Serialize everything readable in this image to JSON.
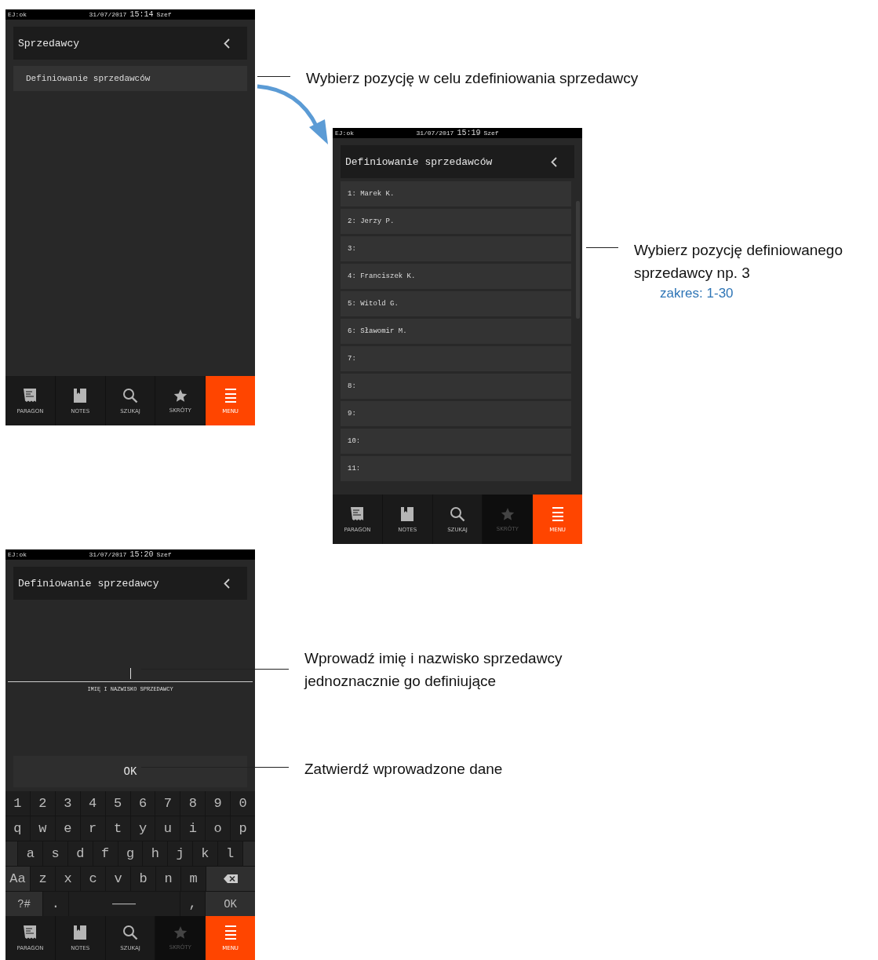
{
  "screens": [
    {
      "kind": "menu",
      "status": {
        "left": "EJ:ok",
        "date": "31/07/2017",
        "time": "15:14",
        "user": "Szef"
      },
      "title": "Sprzedawcy",
      "items": [
        {
          "label": "Definiowanie sprzedawców"
        }
      ],
      "nav": [
        {
          "label": "PARAGON",
          "selected": false,
          "disabled": false
        },
        {
          "label": "NOTES",
          "selected": false,
          "disabled": false
        },
        {
          "label": "SZUKAJ",
          "selected": false,
          "disabled": false
        },
        {
          "label": "SKRÓTY",
          "selected": false,
          "disabled": false
        },
        {
          "label": "MENU",
          "selected": true,
          "disabled": false
        }
      ]
    },
    {
      "kind": "list",
      "status": {
        "left": "EJ:ok",
        "date": "31/07/2017",
        "time": "15:19",
        "user": "Szef"
      },
      "title": "Definiowanie sprzedawców",
      "items": [
        {
          "label": "1: Marek K."
        },
        {
          "label": "2: Jerzy P."
        },
        {
          "label": "3:"
        },
        {
          "label": "4: Franciszek K."
        },
        {
          "label": "5: Witold G."
        },
        {
          "label": "6: Sławomir M."
        },
        {
          "label": "7:"
        },
        {
          "label": "8:"
        },
        {
          "label": "9:"
        },
        {
          "label": "10:"
        },
        {
          "label": "11:"
        }
      ],
      "nav": [
        {
          "label": "PARAGON",
          "selected": false,
          "disabled": false
        },
        {
          "label": "NOTES",
          "selected": false,
          "disabled": false
        },
        {
          "label": "SZUKAJ",
          "selected": false,
          "disabled": false
        },
        {
          "label": "SKRÓTY",
          "selected": false,
          "disabled": true
        },
        {
          "label": "MENU",
          "selected": true,
          "disabled": false
        }
      ]
    },
    {
      "kind": "form",
      "status": {
        "left": "EJ:ok",
        "date": "31/07/2017",
        "time": "15:20",
        "user": "Szef"
      },
      "title": "Definiowanie sprzedawcy",
      "input": {
        "label": "IMIĘ I NAZWISKO SPRZEDAWCY"
      },
      "ok_button": "OK",
      "keyboard": [
        {
          "keys": [
            {
              "kind": "char",
              "label": "1"
            },
            {
              "kind": "char",
              "label": "2"
            },
            {
              "kind": "char",
              "label": "3"
            },
            {
              "kind": "char",
              "label": "4"
            },
            {
              "kind": "char",
              "label": "5"
            },
            {
              "kind": "char",
              "label": "6"
            },
            {
              "kind": "char",
              "label": "7"
            },
            {
              "kind": "char",
              "label": "8"
            },
            {
              "kind": "char",
              "label": "9"
            },
            {
              "kind": "char",
              "label": "0"
            }
          ]
        },
        {
          "keys": [
            {
              "kind": "char",
              "label": "q"
            },
            {
              "kind": "char",
              "label": "w"
            },
            {
              "kind": "char",
              "label": "e"
            },
            {
              "kind": "char",
              "label": "r"
            },
            {
              "kind": "char",
              "label": "t"
            },
            {
              "kind": "char",
              "label": "y"
            },
            {
              "kind": "char",
              "label": "u"
            },
            {
              "kind": "char",
              "label": "i"
            },
            {
              "kind": "char",
              "label": "o"
            },
            {
              "kind": "char",
              "label": "p"
            }
          ]
        },
        {
          "keys": [
            {
              "kind": "spacer"
            },
            {
              "kind": "char",
              "label": "a"
            },
            {
              "kind": "char",
              "label": "s"
            },
            {
              "kind": "char",
              "label": "d"
            },
            {
              "kind": "char",
              "label": "f"
            },
            {
              "kind": "char",
              "label": "g"
            },
            {
              "kind": "char",
              "label": "h"
            },
            {
              "kind": "char",
              "label": "j"
            },
            {
              "kind": "char",
              "label": "k"
            },
            {
              "kind": "char",
              "label": "l"
            },
            {
              "kind": "spacer"
            }
          ]
        },
        {
          "keys": [
            {
              "kind": "shift",
              "label": "Aa"
            },
            {
              "kind": "char",
              "label": "z"
            },
            {
              "kind": "char",
              "label": "x"
            },
            {
              "kind": "char",
              "label": "c"
            },
            {
              "kind": "char",
              "label": "v"
            },
            {
              "kind": "char",
              "label": "b"
            },
            {
              "kind": "char",
              "label": "n"
            },
            {
              "kind": "char",
              "label": "m"
            },
            {
              "kind": "backspace"
            }
          ]
        },
        {
          "keys": [
            {
              "kind": "symbols",
              "label": "?#"
            },
            {
              "kind": "char",
              "label": "."
            },
            {
              "kind": "space"
            },
            {
              "kind": "char",
              "label": ","
            },
            {
              "kind": "enter",
              "label": "OK"
            }
          ]
        }
      ],
      "nav": [
        {
          "label": "PARAGON",
          "selected": false,
          "disabled": false
        },
        {
          "label": "NOTES",
          "selected": false,
          "disabled": false
        },
        {
          "label": "SZUKAJ",
          "selected": false,
          "disabled": false
        },
        {
          "label": "SKRÓTY",
          "selected": false,
          "disabled": true
        },
        {
          "label": "MENU",
          "selected": true,
          "disabled": false
        }
      ]
    }
  ],
  "annotations": [
    {
      "text": "Wybierz pozycję w celu zdefiniowania sprzedawcy"
    },
    {
      "text": "Wybierz pozycję definiowanego sprzedawcy np. 3",
      "note": "zakres: 1-30"
    },
    {
      "text": "Wprowadź imię i nazwisko sprzedawcy jednoznacznie go definiujące"
    },
    {
      "text": "Zatwierdź wprowadzone dane"
    }
  ]
}
